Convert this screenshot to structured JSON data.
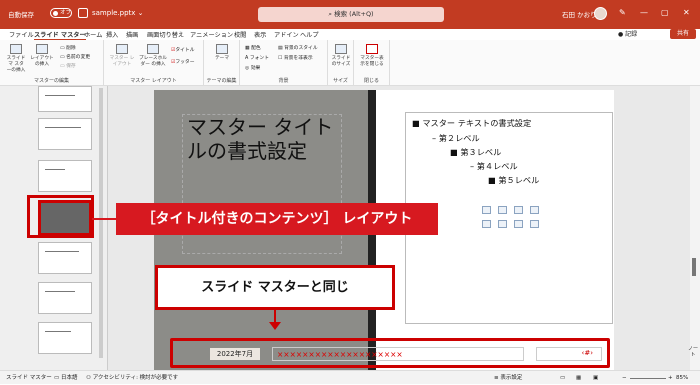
{
  "titlebar": {
    "autosave": "自動保存",
    "toggle": "オフ",
    "filename": "sample.pptx ⌄",
    "search": "検索 (Alt+Q)",
    "user": "石田 かおり",
    "minimize": "—",
    "maximize": "▢",
    "close": "✕"
  },
  "menu": {
    "items": [
      "ファイル",
      "スライド マスター",
      "ホーム",
      "挿入",
      "描画",
      "画面切り替え",
      "アニメーション",
      "校閲",
      "表示",
      "アドイン",
      "ヘルプ"
    ],
    "record": "● 記録",
    "share": "共有"
  },
  "ribbon": {
    "insert_slide_master": "スライドマ スターの挿入",
    "insert_layout": "レイアウトの挿入",
    "delete": "削除",
    "rename": "名前の変更",
    "preserve": "保存",
    "group_edit": "マスターの編集",
    "master_layout": "マスター レイアウト",
    "insert_placeholder": "プレースホルダー の挿入",
    "title_check": "タイトル",
    "footer_check": "フッター",
    "group_layout": "マスター レイアウト",
    "themes": "テーマ",
    "group_theme": "テーマの編集",
    "colors": "配色",
    "fonts": "フォント",
    "effects": "効果",
    "bg_styles": "背景のスタイル",
    "hide_bg": "背景を非表示",
    "group_bg": "背景",
    "slide_size": "スライドのサイズ",
    "group_size": "サイズ",
    "close_master": "マスター表示を閉じる",
    "group_close": "閉じる"
  },
  "slide": {
    "title": "マスター タイトルの書式設定",
    "levels": [
      "マスター テキストの書式設定",
      "第２レベル",
      "第３レベル",
      "第４レベル",
      "第５レベル"
    ],
    "date": "2022年7月",
    "footer_text": "××××××××××××××××××××",
    "page_marker": "‹#›"
  },
  "callouts": {
    "layout": "［タイトル付きのコンテンツ］ レイアウト",
    "same": "スライド マスターと同じ"
  },
  "side": {
    "notes": "ノート"
  },
  "status": {
    "view": "スライド マスター",
    "lang": "日本語",
    "accessibility": "アクセシビリティ: 検討が必要です",
    "display": "表示設定",
    "zoom": "85%"
  }
}
